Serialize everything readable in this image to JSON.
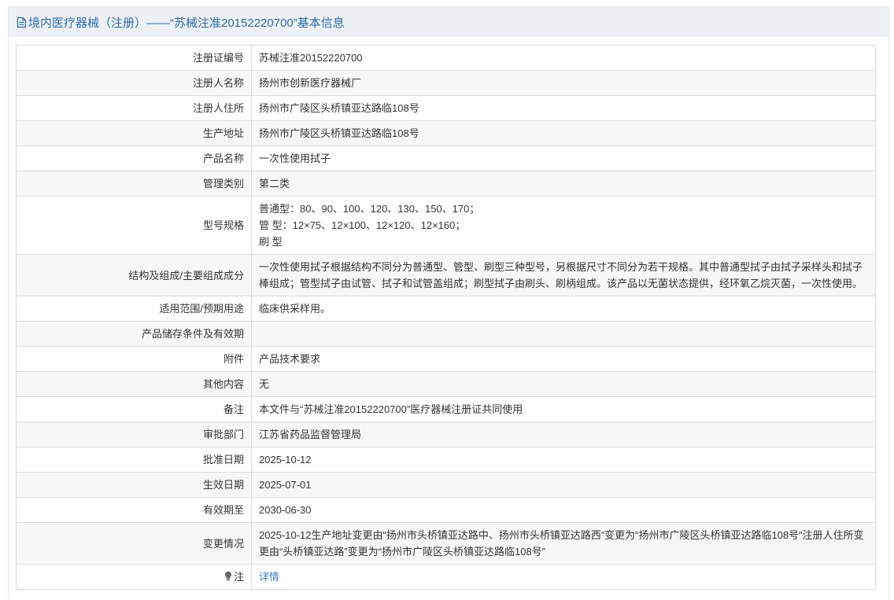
{
  "header": {
    "icon": "document-icon",
    "title": "境内医疗器械（注册）——“苏械注准20152220700”基本信息"
  },
  "colors": {
    "accent": "#2b6cb0",
    "link": "#3b7fd0",
    "header_bg": "#eef1f4",
    "stripe_bg": "#f7f7f7",
    "border": "#dcdcdc",
    "text": "#333333"
  },
  "rows": [
    {
      "label": "注册证编号",
      "value": "苏械注准20152220700"
    },
    {
      "label": "注册人名称",
      "value": "扬州市创新医疗器械厂"
    },
    {
      "label": "注册人住所",
      "value": "扬州市广陵区头桥镇亚达路临108号"
    },
    {
      "label": "生产地址",
      "value": "扬州市广陵区头桥镇亚达路临108号"
    },
    {
      "label": "产品名称",
      "value": "一次性使用拭子"
    },
    {
      "label": "管理类别",
      "value": "第二类"
    },
    {
      "label": "型号规格",
      "lines": [
        "普通型：80、90、100、120、130、150、170；",
        "管 型：12×75、12×100、12×120、12×160；",
        "刷 型"
      ]
    },
    {
      "label": "结构及组成/主要组成成分",
      "value": "一次性使用拭子根据结构不同分为普通型、管型、刷型三种型号，另根据尺寸不同分为若干规格。其中普通型拭子由拭子采样头和拭子棒组成；管型拭子由试管、拭子和试管盖组成；刷型拭子由刷头、刷柄组成。该产品以无菌状态提供，经环氧乙烷灭菌，一次性使用。"
    },
    {
      "label": "适用范围/预期用途",
      "value": "临床供采样用。"
    },
    {
      "label": "产品储存条件及有效期",
      "value": ""
    },
    {
      "label": "附件",
      "value": "产品技术要求"
    },
    {
      "label": "其他内容",
      "value": "无"
    },
    {
      "label": "备注",
      "value": "本文件与“苏械注准20152220700”医疗器械注册证共同使用"
    },
    {
      "label": "审批部门",
      "value": "江苏省药品监督管理局"
    },
    {
      "label": "批准日期",
      "value": "2025-10-12"
    },
    {
      "label": "生效日期",
      "value": "2025-07-01"
    },
    {
      "label": "有效期至",
      "value": "2030-06-30"
    },
    {
      "label": "变更情况",
      "value": "2025-10-12生产地址变更由“扬州市头桥镇亚达路中、扬州市头桥镇亚达路西”变更为“扬州市广陵区头桥镇亚达路临108号”注册人住所变更由“头桥镇亚达路”变更为“扬州市广陵区头桥镇亚达路临108号”"
    },
    {
      "label": "注",
      "icon": "lightbulb-icon",
      "link": "详情"
    }
  ]
}
